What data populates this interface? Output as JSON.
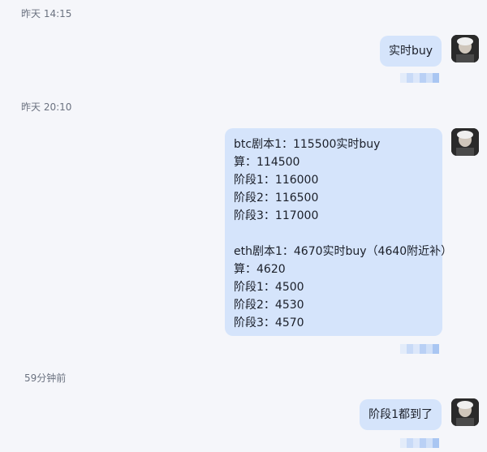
{
  "messages": [
    {
      "timestamp": "昨天 14:15",
      "text_lines": [
        "实时buy"
      ]
    },
    {
      "timestamp": "昨天 20:10",
      "text_lines": [
        "btc剧本1：115500实时buy",
        "算：114500",
        "阶段1：116000",
        "阶段2：116500",
        "阶段3：117000",
        "",
        "eth剧本1：4670实时buy（4640附近补）",
        "算：4620",
        "阶段1：4500",
        "阶段2：4530",
        "阶段3：4570"
      ]
    },
    {
      "timestamp": "59分钟前",
      "text_lines": [
        "阶段1都到了"
      ]
    }
  ],
  "colors": {
    "background": "#f5f6fa",
    "bubble": "#d5e4fb",
    "timestamp": "#6b7280"
  },
  "icons": [
    "user-avatar",
    "blurred-status-indicator"
  ]
}
